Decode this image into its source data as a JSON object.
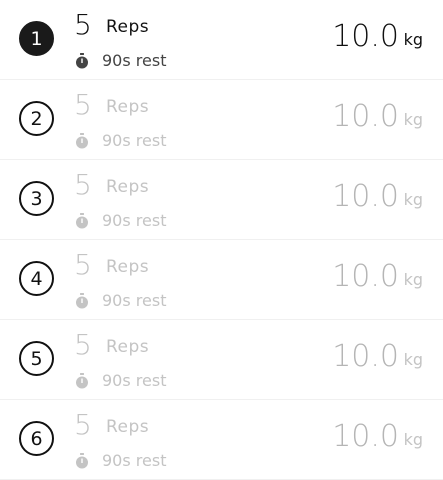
{
  "colors": {
    "active_text": "#111111",
    "inactive_text": "#c4c4c4",
    "active_badge": "#1a1a1a"
  },
  "sets": [
    {
      "number": "1",
      "reps": "5",
      "reps_label": "Reps",
      "rest": "90s rest",
      "weight": "10.0",
      "unit": "kg",
      "state": "active"
    },
    {
      "number": "2",
      "reps": "5",
      "reps_label": "Reps",
      "rest": "90s rest",
      "weight": "10.0",
      "unit": "kg",
      "state": "inactive"
    },
    {
      "number": "3",
      "reps": "5",
      "reps_label": "Reps",
      "rest": "90s rest",
      "weight": "10.0",
      "unit": "kg",
      "state": "inactive"
    },
    {
      "number": "4",
      "reps": "5",
      "reps_label": "Reps",
      "rest": "90s rest",
      "weight": "10.0",
      "unit": "kg",
      "state": "inactive"
    },
    {
      "number": "5",
      "reps": "5",
      "reps_label": "Reps",
      "rest": "90s rest",
      "weight": "10.0",
      "unit": "kg",
      "state": "inactive"
    },
    {
      "number": "6",
      "reps": "5",
      "reps_label": "Reps",
      "rest": "90s rest",
      "weight": "10.0",
      "unit": "kg",
      "state": "inactive"
    }
  ],
  "icons": {
    "rest": "stopwatch-icon"
  }
}
